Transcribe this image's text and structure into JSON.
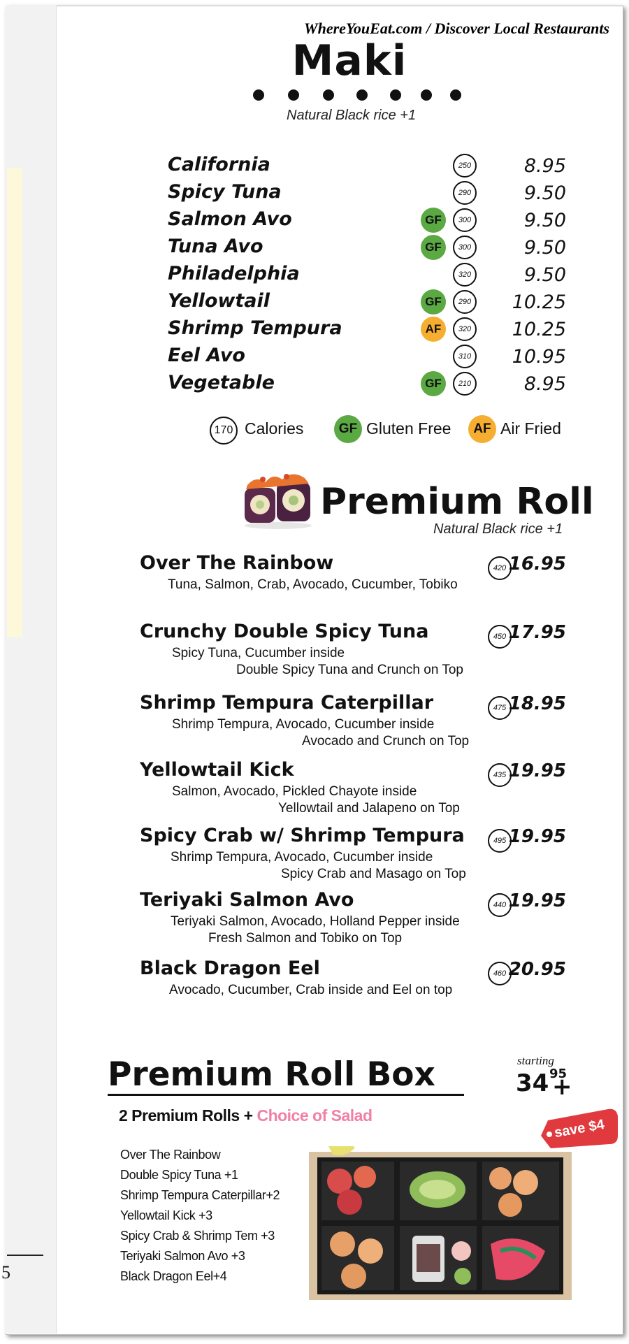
{
  "header": {
    "site": "WhereYouEat.com / Discover Local Restaurants"
  },
  "maki": {
    "title": "Maki",
    "subtitle": "Natural Black rice +1",
    "items": [
      {
        "name": "California",
        "cal": "250",
        "badge": "",
        "price": "8.95"
      },
      {
        "name": "Spicy Tuna",
        "cal": "290",
        "badge": "",
        "price": "9.50"
      },
      {
        "name": "Salmon Avo",
        "cal": "300",
        "badge": "GF",
        "price": "9.50"
      },
      {
        "name": "Tuna Avo",
        "cal": "300",
        "badge": "GF",
        "price": "9.50"
      },
      {
        "name": "Philadelphia",
        "cal": "320",
        "badge": "",
        "price": "9.50"
      },
      {
        "name": "Yellowtail",
        "cal": "290",
        "badge": "GF",
        "price": "10.25"
      },
      {
        "name": "Shrimp Tempura",
        "cal": "320",
        "badge": "AF",
        "price": "10.25"
      },
      {
        "name": "Eel Avo",
        "cal": "310",
        "badge": "",
        "price": "10.95"
      },
      {
        "name": "Vegetable",
        "cal": "210",
        "badge": "GF",
        "price": "8.95"
      }
    ]
  },
  "legend": {
    "cal_sample": "170",
    "cal_label": "Calories",
    "gf": "GF",
    "gf_label": "Gluten Free",
    "af": "AF",
    "af_label": "Air Fried"
  },
  "premium": {
    "title": "Premium Roll",
    "subtitle": "Natural Black rice +1",
    "rolls": [
      {
        "name": "Over The Rainbow",
        "cal": "420",
        "price": "16.95",
        "desc": [
          "Tuna, Salmon, Crab, Avocado, Cucumber, Tobiko"
        ]
      },
      {
        "name": "Crunchy Double Spicy Tuna",
        "cal": "450",
        "price": "17.95",
        "desc": [
          "Spicy Tuna, Cucumber inside",
          "Double Spicy Tuna and Crunch on Top"
        ]
      },
      {
        "name": "Shrimp Tempura Caterpillar",
        "cal": "475",
        "price": "18.95",
        "desc": [
          "Shrimp Tempura, Avocado, Cucumber inside",
          "Avocado and Crunch on Top"
        ]
      },
      {
        "name": "Yellowtail Kick",
        "cal": "435",
        "price": "19.95",
        "desc": [
          "Salmon, Avocado, Pickled Chayote inside",
          "Yellowtail  and Jalapeno on Top"
        ]
      },
      {
        "name": "Spicy Crab w/ Shrimp Tempura",
        "cal": "495",
        "price": "19.95",
        "desc": [
          "Shrimp Tempura, Avocado, Cucumber inside",
          "Spicy Crab and Masago on Top"
        ]
      },
      {
        "name": "Teriyaki Salmon Avo",
        "cal": "440",
        "price": "19.95",
        "desc": [
          "Teriyaki Salmon, Avocado, Holland Pepper inside",
          "Fresh Salmon and Tobiko on Top"
        ]
      },
      {
        "name": "Black Dragon Eel",
        "cal": "460",
        "price": "20.95",
        "desc": [
          "Avocado, Cucumber, Crab inside and Eel on top"
        ]
      }
    ]
  },
  "box": {
    "title": "Premium Roll Box",
    "starting_label": "starting",
    "price_main": "34",
    "price_cents": "95",
    "price_plus": "+",
    "line_prefix": "2 Premium Rolls + ",
    "line_highlight": "Choice of Salad",
    "options": [
      "Over The Rainbow",
      "Double Spicy Tuna +1",
      "Shrimp Tempura Caterpillar+2",
      "Yellowtail Kick +3",
      "Spicy Crab & Shrimp Tem +3",
      "Teriyaki Salmon Avo +3",
      "Black Dragon Eel+4"
    ],
    "save_tag": "save $4"
  },
  "page_number": "5"
}
